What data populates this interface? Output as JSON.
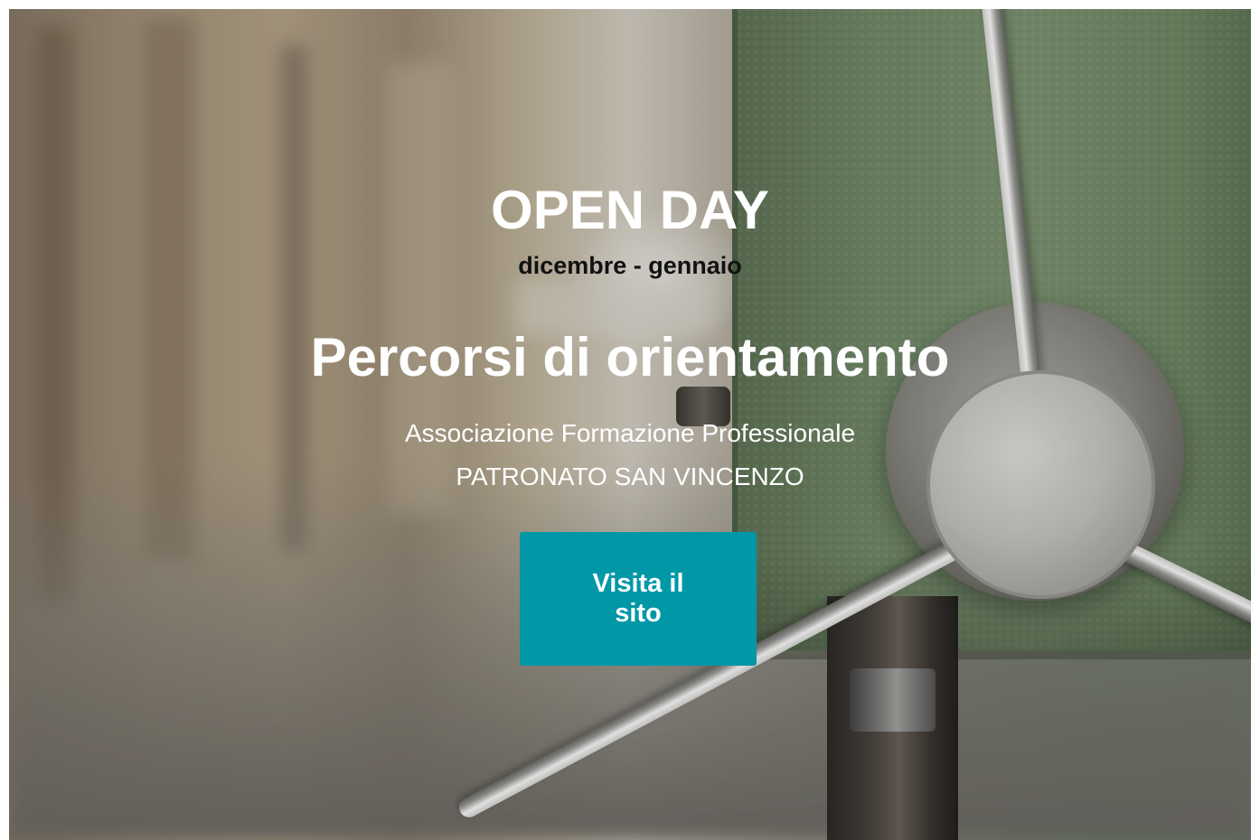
{
  "hero": {
    "title": "OPEN DAY",
    "subtitle": "dicembre - gennaio",
    "heading": "Percorsi di orientamento",
    "org_line1": "Associazione Formazione Professionale",
    "org_line2": "PATRONATO SAN VINCENZO",
    "cta_label": "Visita il sito"
  },
  "colors": {
    "cta_background": "#0097a7",
    "title_text": "#ffffff",
    "subtitle_text": "#111111"
  }
}
